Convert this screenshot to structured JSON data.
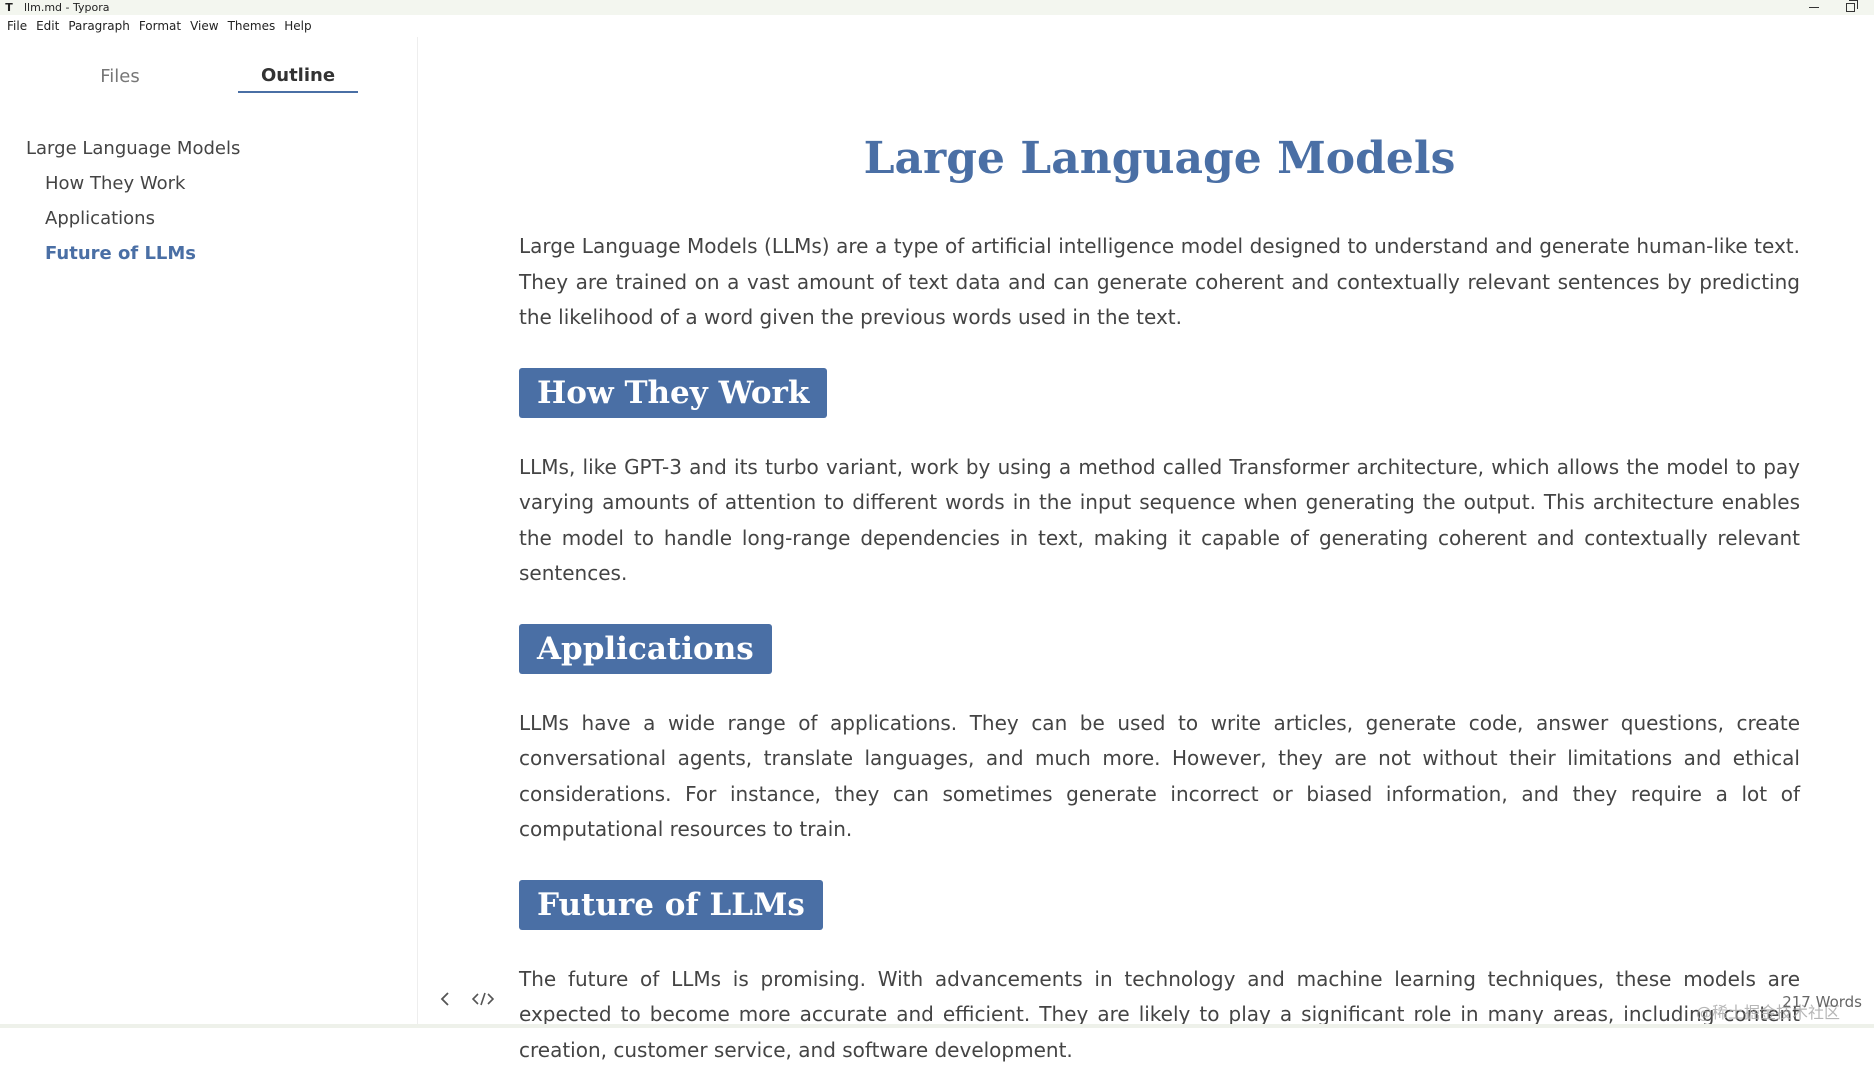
{
  "window": {
    "app_icon": "T",
    "title": "llm.md - Typora"
  },
  "menu": [
    "File",
    "Edit",
    "Paragraph",
    "Format",
    "View",
    "Themes",
    "Help"
  ],
  "sidebar": {
    "tabs": {
      "files": "Files",
      "outline": "Outline"
    },
    "active_tab": "Outline",
    "outline": [
      {
        "label": "Large Language Models",
        "level": 1
      },
      {
        "label": "How They Work",
        "level": 2
      },
      {
        "label": "Applications",
        "level": 2
      },
      {
        "label": "Future of LLMs",
        "level": 2,
        "active": true
      }
    ]
  },
  "document": {
    "title": "Large Language Models",
    "intro": "Large Language Models (LLMs) are a type of artificial intelligence model designed to understand and generate human-like text. They are trained on a vast amount of text data and can generate coherent and contextually relevant sentences by predicting the likelihood of a word given the previous words used in the text.",
    "sections": [
      {
        "heading": "How They Work",
        "body": "LLMs, like GPT-3 and its turbo variant, work by using a method called Transformer architecture, which allows the model to pay varying amounts of attention to different words in the input sequence when generating the output. This architecture enables the model to handle long-range dependencies in text, making it capable of generating coherent and contextually relevant sentences."
      },
      {
        "heading": "Applications",
        "body": "LLMs have a wide range of applications. They can be used to write articles, generate code, answer questions, create conversational agents, translate languages, and much more. However, they are not without their limitations and ethical considerations. For instance, they can sometimes generate incorrect or biased information, and they require a lot of computational resources to train."
      },
      {
        "heading": "Future of LLMs",
        "body": "The future of LLMs is promising. With advancements in technology and machine learning techniques, these models are expected to become more accurate and efficient. They are likely to play a significant role in many areas, including content creation, customer service, and software development."
      }
    ]
  },
  "footer": {
    "back_icon": "chevron-left-icon",
    "source_icon": "code-icon",
    "word_count": "217 Words",
    "watermark": "@稀土掘金技术社区"
  },
  "colors": {
    "accent": "#4a6fa5",
    "text": "#444444"
  }
}
